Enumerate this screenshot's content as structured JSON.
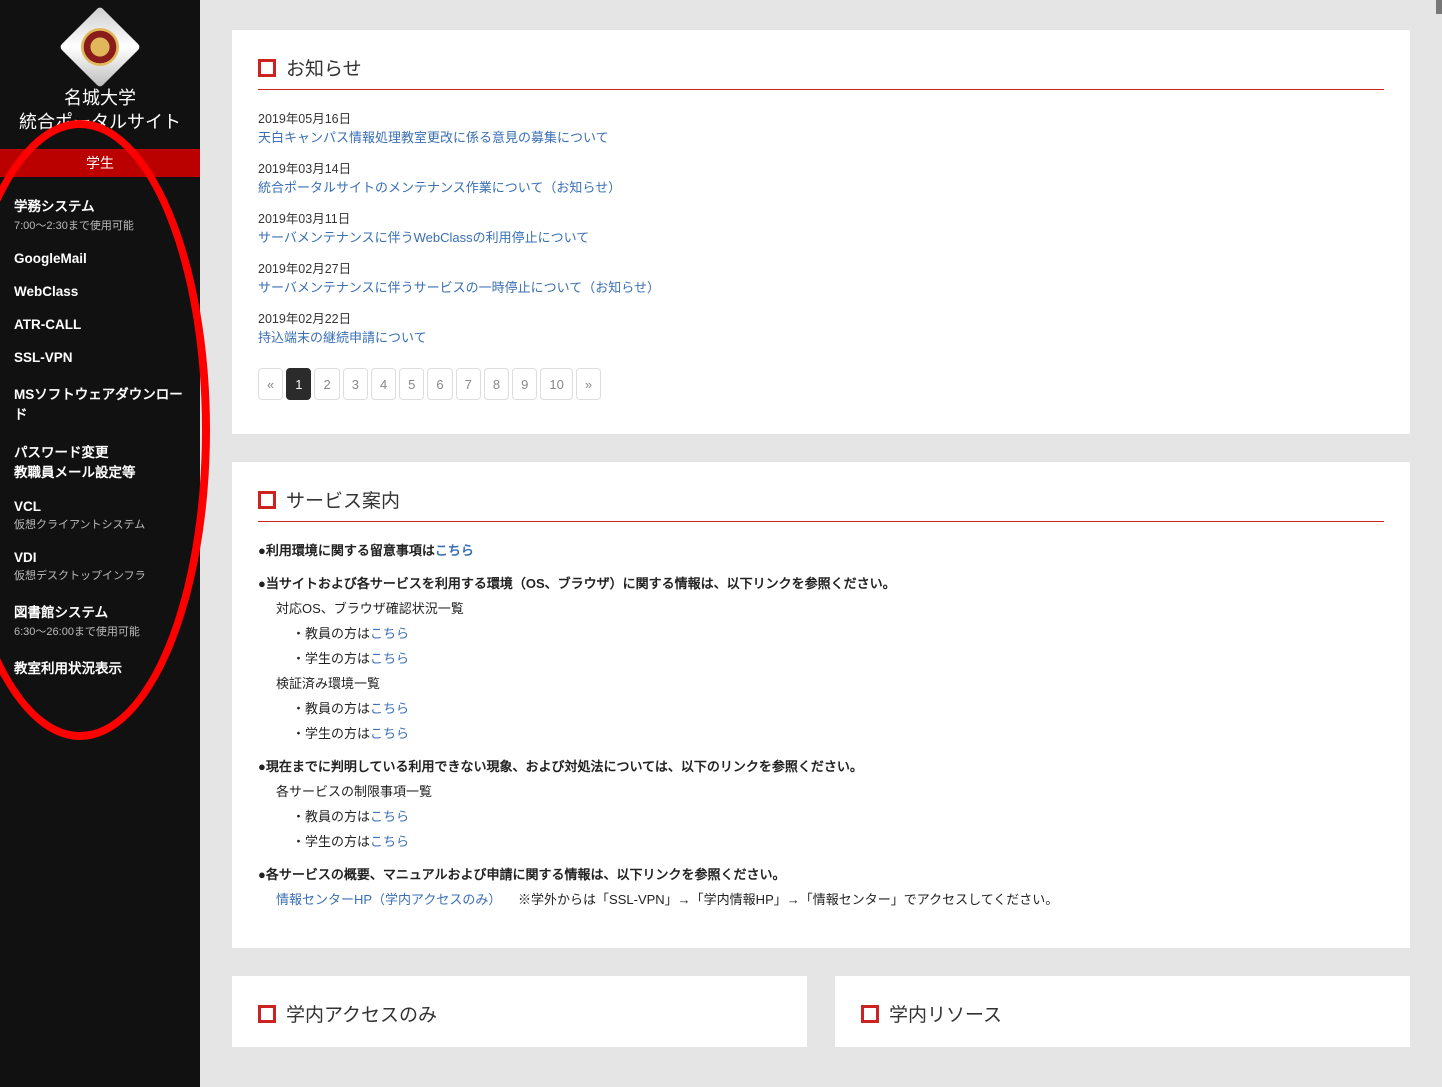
{
  "sidebar": {
    "univ_line1": "名城大学",
    "univ_line2": "統合ポータルサイト",
    "role": "学生",
    "items": [
      {
        "label": "学務システム",
        "note": "7:00～2:30まで使用可能"
      },
      {
        "label": "GoogleMail",
        "note": ""
      },
      {
        "label": "WebClass",
        "note": ""
      },
      {
        "label": "ATR-CALL",
        "note": ""
      },
      {
        "label": "SSL-VPN",
        "note": ""
      },
      {
        "label": "MSソフトウェアダウンロード",
        "note": ""
      },
      {
        "label": "パスワード変更\n教職員メール設定等",
        "note": ""
      },
      {
        "label": "VCL",
        "note": "仮想クライアントシステム"
      },
      {
        "label": "VDI",
        "note": "仮想デスクトップインフラ"
      },
      {
        "label": "図書館システム",
        "note": "6:30～26:00まで使用可能"
      },
      {
        "label": "教室利用状況表示",
        "note": ""
      }
    ]
  },
  "news": {
    "title": "お知らせ",
    "items": [
      {
        "date": "2019年05月16日",
        "link": "天白キャンパス情報処理教室更改に係る意見の募集について"
      },
      {
        "date": "2019年03月14日",
        "link": "統合ポータルサイトのメンテナンス作業について（お知らせ）"
      },
      {
        "date": "2019年03月11日",
        "link": "サーバメンテナンスに伴うWebClassの利用停止について"
      },
      {
        "date": "2019年02月27日",
        "link": "サーバメンテナンスに伴うサービスの一時停止について（お知らせ）"
      },
      {
        "date": "2019年02月22日",
        "link": "持込端末の継続申請について"
      }
    ],
    "pages": [
      "«",
      "1",
      "2",
      "3",
      "4",
      "5",
      "6",
      "7",
      "8",
      "9",
      "10",
      "»"
    ],
    "active_page": "1"
  },
  "service_guide": {
    "title": "サービス案内",
    "b1_prefix": "●利用環境に関する留意事項は",
    "b1_link": "こちら",
    "b2": "●当サイトおよび各サービスを利用する環境（OS、ブラウザ）に関する情報は、以下リンクを参照ください。",
    "b2_l1": "対応OS、ブラウザ確認状況一覧",
    "b2_teacher_prefix": "・教員の方は",
    "b2_student_prefix": "・学生の方は",
    "b2_verified": "検証済み環境一覧",
    "kochira": "こちら",
    "b3": "●現在までに判明している利用できない現象、および対処法については、以下のリンクを参照ください。",
    "b3_l1": "各サービスの制限事項一覧",
    "b4": "●各サービスの概要、マニュアルおよび申請に関する情報は、以下リンクを参照ください。",
    "b4_link": "情報センターHP（学内アクセスのみ）",
    "b4_note": "　※学外からは「SSL-VPN」→「学内情報HP」→「情報センター」でアクセスしてください。"
  },
  "bottom": {
    "left_title": "学内アクセスのみ",
    "right_title": "学内リソース"
  }
}
